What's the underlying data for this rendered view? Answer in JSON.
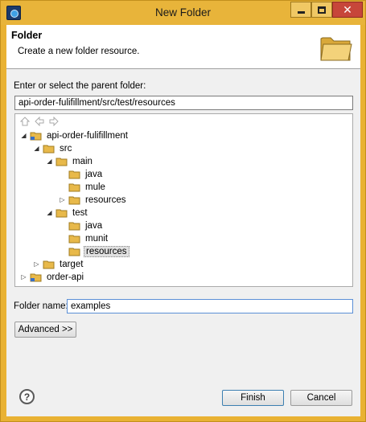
{
  "window": {
    "title": "New Folder",
    "minimize_icon": "minimize-icon",
    "maximize_icon": "maximize-icon",
    "close_icon": "close-icon",
    "close_glyph": "✕",
    "app_icon": "eclipse-icon"
  },
  "header": {
    "title": "Folder",
    "description": "Create a new folder resource.",
    "image_icon": "folder-large-icon"
  },
  "parent": {
    "label": "Enter or select the parent folder:",
    "value": "api-order-fulifillment/src/test/resources"
  },
  "toolbar": {
    "home_icon": "home-icon",
    "back_icon": "back-arrow-icon",
    "forward_icon": "forward-arrow-icon"
  },
  "tree": {
    "items": [
      {
        "label": "api-order-fulifillment",
        "expanded": true,
        "type": "project"
      },
      {
        "label": "src",
        "expanded": true,
        "type": "folder"
      },
      {
        "label": "main",
        "expanded": true,
        "type": "folder"
      },
      {
        "label": "java",
        "expanded": null,
        "type": "folder"
      },
      {
        "label": "mule",
        "expanded": null,
        "type": "folder"
      },
      {
        "label": "resources",
        "expanded": false,
        "type": "folder"
      },
      {
        "label": "test",
        "expanded": true,
        "type": "folder"
      },
      {
        "label": "java",
        "expanded": null,
        "type": "folder"
      },
      {
        "label": "munit",
        "expanded": null,
        "type": "folder"
      },
      {
        "label": "resources",
        "expanded": null,
        "type": "folder",
        "selected": true
      },
      {
        "label": "target",
        "expanded": false,
        "type": "folder"
      },
      {
        "label": "order-api",
        "expanded": false,
        "type": "project"
      }
    ]
  },
  "folder_name": {
    "label": "Folder name:",
    "value": "examples"
  },
  "buttons": {
    "advanced": "Advanced >>",
    "finish": "Finish",
    "cancel": "Cancel",
    "help_glyph": "?"
  },
  "colors": {
    "title_bar": "#e8b43a",
    "close_button": "#c7463a",
    "folder": "#e8b94a",
    "selection": "#e0e0e0"
  }
}
